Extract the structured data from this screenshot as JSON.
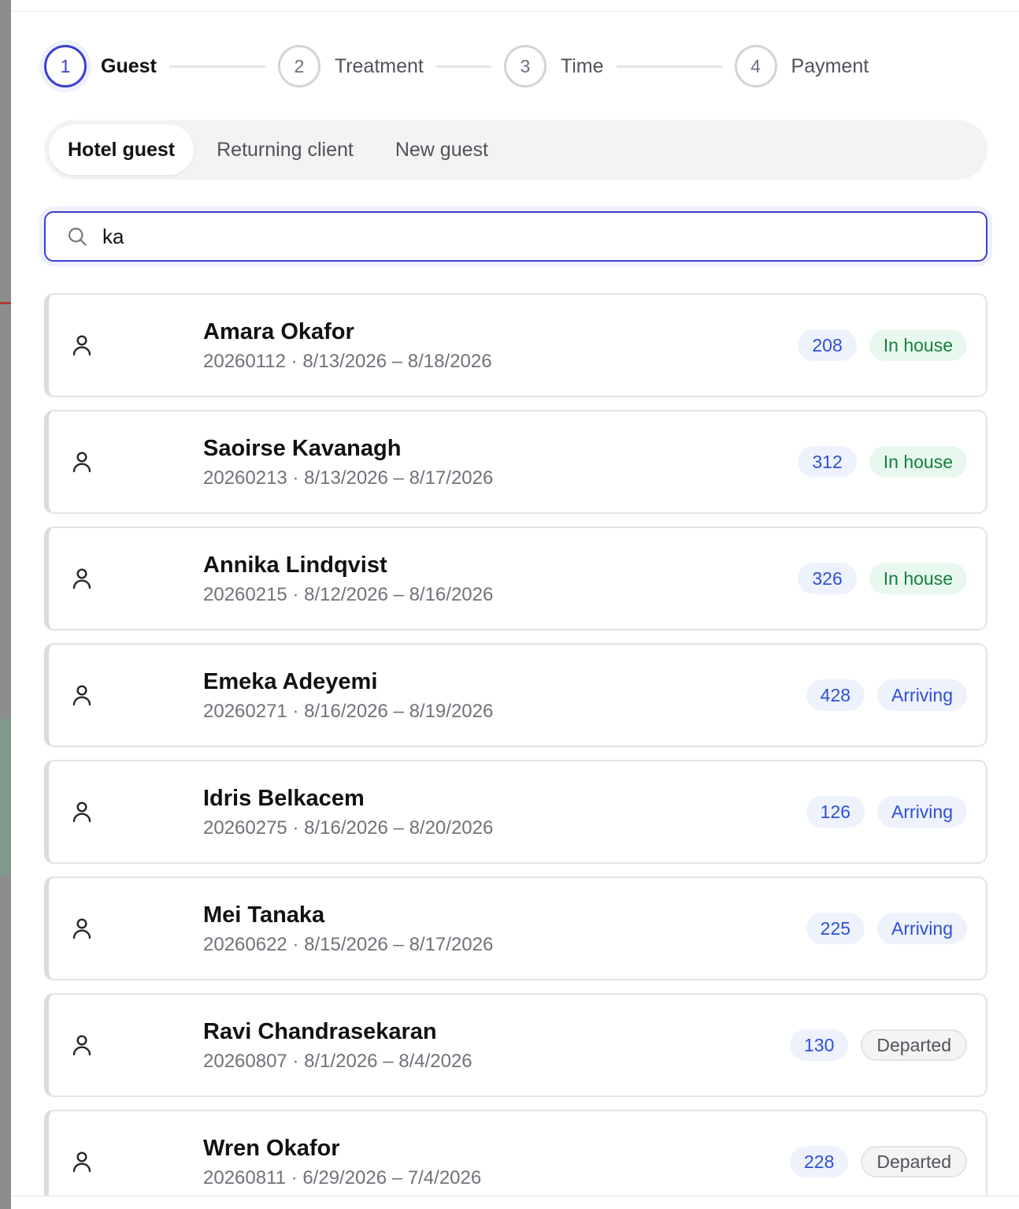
{
  "stepper": {
    "steps": [
      {
        "number": "1",
        "label": "Guest"
      },
      {
        "number": "2",
        "label": "Treatment"
      },
      {
        "number": "3",
        "label": "Time"
      },
      {
        "number": "4",
        "label": "Payment"
      }
    ],
    "active_step": "1"
  },
  "tabs": {
    "items": [
      "Hotel guest",
      "Returning client",
      "New guest"
    ],
    "active": "Hotel guest"
  },
  "search": {
    "value": "ka",
    "icon": "search-icon"
  },
  "colors": {
    "accent": "#3b3fd0",
    "in_house_text": "#15803d",
    "in_house_bg": "#e9f8ef",
    "arriving_text": "#2f4fd8",
    "arriving_bg": "#eef2fc",
    "departed_text": "#52525b"
  },
  "guests": [
    {
      "name": "Amara Okafor",
      "meta": "20260112 · 8/13/2026 – 8/18/2026",
      "room": "208",
      "status": "In house"
    },
    {
      "name": "Saoirse Kavanagh",
      "meta": "20260213 · 8/13/2026 – 8/17/2026",
      "room": "312",
      "status": "In house"
    },
    {
      "name": "Annika Lindqvist",
      "meta": "20260215 · 8/12/2026 – 8/16/2026",
      "room": "326",
      "status": "In house"
    },
    {
      "name": "Emeka Adeyemi",
      "meta": "20260271 · 8/16/2026 – 8/19/2026",
      "room": "428",
      "status": "Arriving"
    },
    {
      "name": "Idris Belkacem",
      "meta": "20260275 · 8/16/2026 – 8/20/2026",
      "room": "126",
      "status": "Arriving"
    },
    {
      "name": "Mei Tanaka",
      "meta": "20260622 · 8/15/2026 – 8/17/2026",
      "room": "225",
      "status": "Arriving"
    },
    {
      "name": "Ravi Chandrasekaran",
      "meta": "20260807 · 8/1/2026 – 8/4/2026",
      "room": "130",
      "status": "Departed"
    },
    {
      "name": "Wren Okafor",
      "meta": "20260811 · 6/29/2026 – 7/4/2026",
      "room": "228",
      "status": "Departed"
    }
  ]
}
